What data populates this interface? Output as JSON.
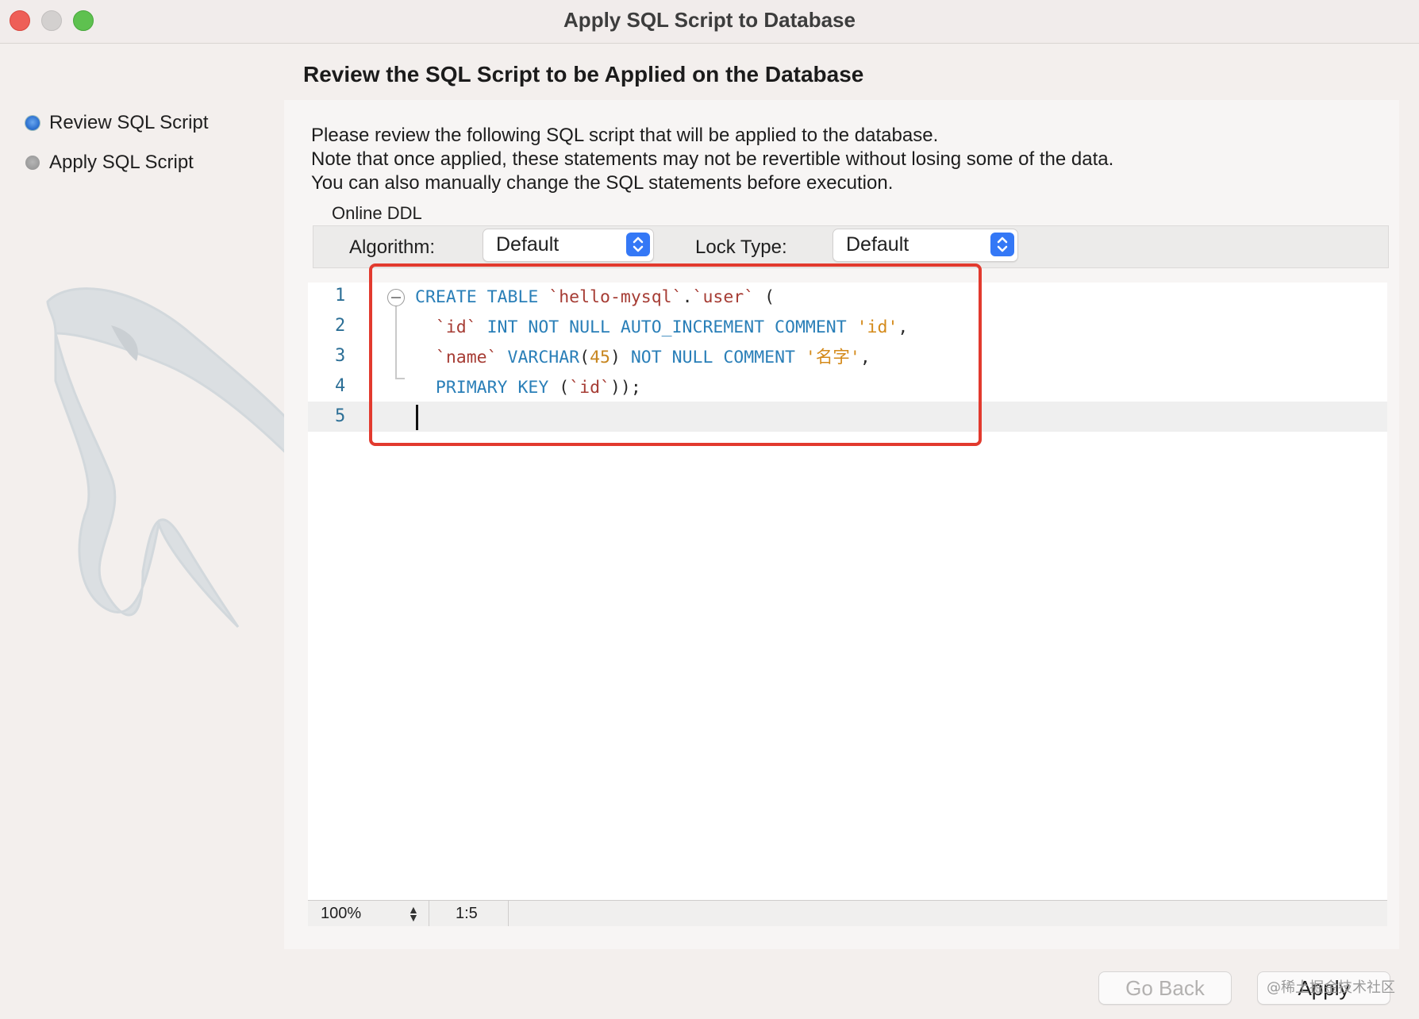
{
  "window": {
    "title": "Apply SQL Script to Database"
  },
  "sidebar": {
    "steps": [
      {
        "label": "Review SQL Script",
        "active": true
      },
      {
        "label": "Apply SQL Script",
        "active": false
      }
    ]
  },
  "main": {
    "title": "Review the SQL Script to be Applied on the Database",
    "description": [
      "Please review the following SQL script that will be applied to the database.",
      "Note that once applied, these statements may not be revertible without losing some of the data.",
      "You can also manually change the SQL statements before execution."
    ],
    "online_ddl": {
      "label": "Online DDL",
      "algorithm_label": "Algorithm:",
      "algorithm_value": "Default",
      "lock_type_label": "Lock Type:",
      "lock_type_value": "Default"
    },
    "editor": {
      "line_numbers": [
        "1",
        "2",
        "3",
        "4",
        "5"
      ],
      "lines": [
        [
          {
            "t": "kw",
            "v": "CREATE TABLE "
          },
          {
            "t": "ident",
            "v": "`hello-mysql`"
          },
          {
            "t": "plain",
            "v": "."
          },
          {
            "t": "ident",
            "v": "`user`"
          },
          {
            "t": "plain",
            "v": " ("
          }
        ],
        [
          {
            "t": "plain",
            "v": "  "
          },
          {
            "t": "ident",
            "v": "`id`"
          },
          {
            "t": "kw",
            "v": " INT NOT NULL AUTO_INCREMENT COMMENT "
          },
          {
            "t": "str",
            "v": "'id'"
          },
          {
            "t": "plain",
            "v": ","
          }
        ],
        [
          {
            "t": "plain",
            "v": "  "
          },
          {
            "t": "ident",
            "v": "`name`"
          },
          {
            "t": "kw",
            "v": " VARCHAR"
          },
          {
            "t": "plain",
            "v": "("
          },
          {
            "t": "num",
            "v": "45"
          },
          {
            "t": "plain",
            "v": ")"
          },
          {
            "t": "kw",
            "v": " NOT NULL COMMENT "
          },
          {
            "t": "str",
            "v": "'名字'"
          },
          {
            "t": "plain",
            "v": ","
          }
        ],
        [
          {
            "t": "plain",
            "v": "  "
          },
          {
            "t": "kw",
            "v": "PRIMARY KEY "
          },
          {
            "t": "plain",
            "v": "("
          },
          {
            "t": "ident",
            "v": "`id`"
          },
          {
            "t": "plain",
            "v": "));"
          }
        ],
        []
      ]
    },
    "status_bar": {
      "zoom": "100%",
      "cursor_position": "1:5"
    }
  },
  "footer": {
    "go_back_label": "Go Back",
    "apply_label": "Apply",
    "watermark": "@稀土掘金技术社区"
  },
  "colors": {
    "keyword": "#2a7fb8",
    "identifier": "#a63c34",
    "string": "#d48a1a",
    "highlight_box": "#e23a2e",
    "accent": "#3478f6"
  }
}
